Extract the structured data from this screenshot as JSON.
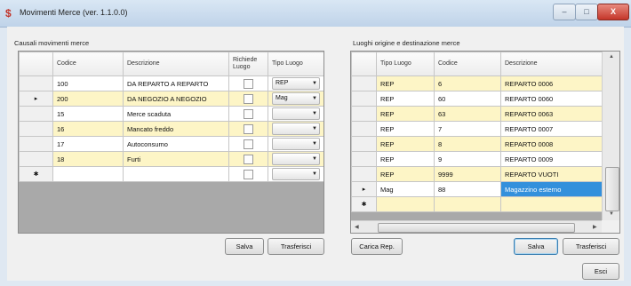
{
  "window": {
    "title": "Movimenti Merce (ver. 1.1.0.0)",
    "app_icon": "$"
  },
  "win_controls": {
    "minimize": "–",
    "maximize": "□",
    "close": "X"
  },
  "left": {
    "group_label": "Causali movimenti merce",
    "columns": [
      "Codice",
      "Descrizione",
      "Richiede Luogo",
      "Tipo Luogo"
    ],
    "rows": [
      {
        "marker": "",
        "codice": "100",
        "descrizione": "DA REPARTO A REPARTO",
        "tipo": "REP",
        "bg": "w"
      },
      {
        "marker": "▸",
        "codice": "200",
        "descrizione": "DA NEGOZIO A NEGOZIO",
        "tipo": "Mag",
        "bg": "y"
      },
      {
        "marker": "",
        "codice": "15",
        "descrizione": "Merce scaduta",
        "tipo": "",
        "bg": "w"
      },
      {
        "marker": "",
        "codice": "16",
        "descrizione": "Mancato freddo",
        "tipo": "",
        "bg": "y"
      },
      {
        "marker": "",
        "codice": "17",
        "descrizione": "Autoconsumo",
        "tipo": "",
        "bg": "w"
      },
      {
        "marker": "",
        "codice": "18",
        "descrizione": "Furti",
        "tipo": "",
        "bg": "y"
      },
      {
        "marker": "✱",
        "codice": "",
        "descrizione": "",
        "tipo": "",
        "bg": "w"
      }
    ],
    "buttons": {
      "salva": "Salva",
      "trasferisci": "Trasferisci"
    }
  },
  "right": {
    "group_label": "Luoghi origine e destinazione merce",
    "columns": [
      "Tipo Luogo",
      "Codice",
      "Descrizione"
    ],
    "rows": [
      {
        "marker": "",
        "tipo": "REP",
        "codice": "6",
        "descrizione": "REPARTO 0006",
        "bg": "y"
      },
      {
        "marker": "",
        "tipo": "REP",
        "codice": "60",
        "descrizione": "REPARTO 0060",
        "bg": "w"
      },
      {
        "marker": "",
        "tipo": "REP",
        "codice": "63",
        "descrizione": "REPARTO 0063",
        "bg": "y"
      },
      {
        "marker": "",
        "tipo": "REP",
        "codice": "7",
        "descrizione": "REPARTO 0007",
        "bg": "w"
      },
      {
        "marker": "",
        "tipo": "REP",
        "codice": "8",
        "descrizione": "REPARTO 0008",
        "bg": "y"
      },
      {
        "marker": "",
        "tipo": "REP",
        "codice": "9",
        "descrizione": "REPARTO 0009",
        "bg": "w"
      },
      {
        "marker": "",
        "tipo": "REP",
        "codice": "9999",
        "descrizione": "REPARTO VUOTI",
        "bg": "y"
      },
      {
        "marker": "▸",
        "tipo": "Mag",
        "codice": "88",
        "descrizione": "Magazzino esterno",
        "bg": "w"
      },
      {
        "marker": "✱",
        "tipo": "",
        "codice": "",
        "descrizione": "",
        "bg": "y"
      }
    ],
    "buttons": {
      "carica_rep": "Carica Rep.",
      "salva": "Salva",
      "trasferisci": "Trasferisci"
    }
  },
  "footer": {
    "esci": "Esci"
  },
  "colors": {
    "selection": "#3390dc",
    "row_alt": "#fdf5c6",
    "grid_bg": "#a9a9a9"
  }
}
